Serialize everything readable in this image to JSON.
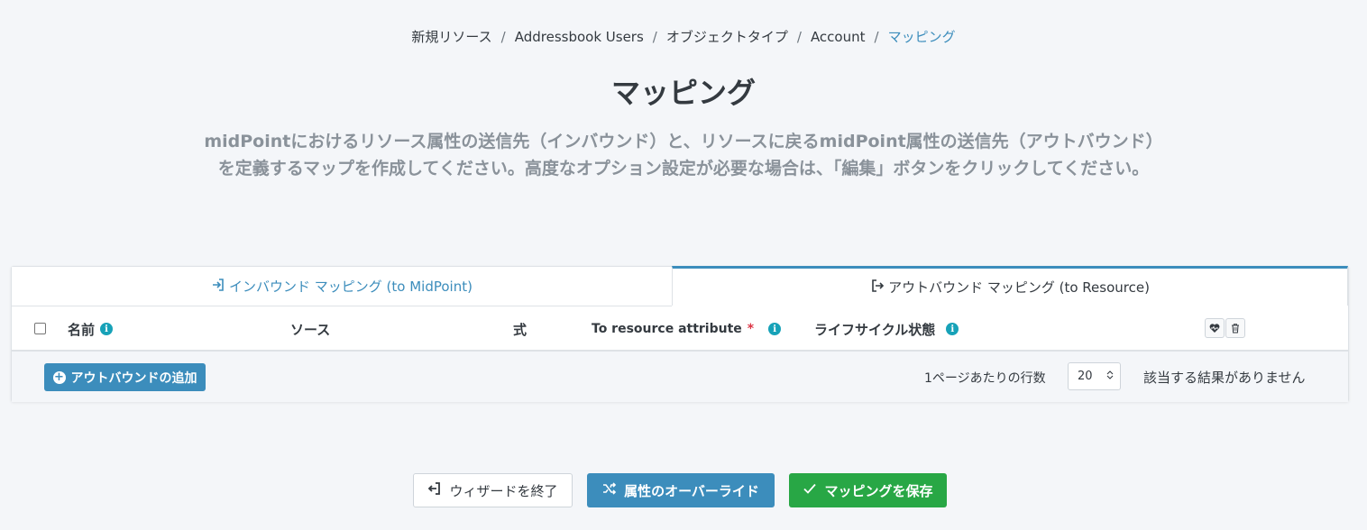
{
  "breadcrumb": {
    "items": [
      "新規リソース",
      "Addressbook Users",
      "オブジェクトタイプ",
      "Account"
    ],
    "active": "マッピング",
    "separator": "/"
  },
  "page": {
    "title": "マッピング",
    "description": "midPointにおけるリソース属性の送信先（インバウンド）と、リソースに戻るmidPoint属性の送信先（アウトバウンド）を定義するマップを作成してください。高度なオプション設定が必要な場合は、「編集」ボタンをクリックしてください。"
  },
  "tabs": {
    "inbound": {
      "label": "インバウンド マッピング (to MidPoint)",
      "icon": "sign-in-icon"
    },
    "outbound": {
      "label": "アウトバウンド マッピング (to Resource)",
      "icon": "sign-out-icon",
      "active": true
    }
  },
  "table": {
    "columns": {
      "name": "名前",
      "source": "ソース",
      "expression": "式",
      "target": "To resource attribute",
      "required_mark": "*",
      "lifecycle": "ライフサイクル状態"
    },
    "info_glyph": "i",
    "rows": []
  },
  "footer": {
    "add_button": "アウトバウンドの追加",
    "add_glyph": "+",
    "rows_per_page_label": "1ページあたりの行数",
    "rows_per_page_value": "20",
    "no_results": "該当する結果がありません"
  },
  "actions": {
    "exit": "ウィザードを終了",
    "override": "属性のオーバーライド",
    "save": "マッピングを保存"
  },
  "colors": {
    "primary": "#3c8dbc",
    "success": "#28a745",
    "info": "#17a2b8",
    "danger": "#dc3545",
    "background": "#f4f6f9"
  }
}
